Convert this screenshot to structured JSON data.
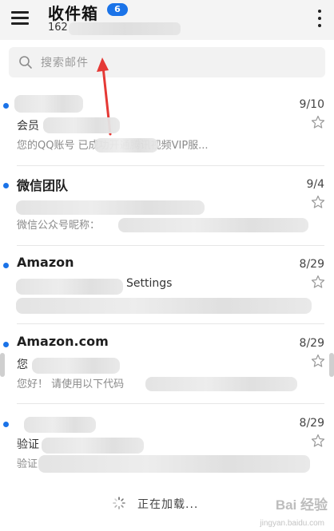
{
  "header": {
    "title": "收件箱",
    "unread_count": "6",
    "account_visible": "162",
    "menu_icon": "hamburger-menu-icon",
    "more_icon": "more-vertical-icon"
  },
  "search": {
    "placeholder": "搜索邮件",
    "icon": "search-icon"
  },
  "mails": [
    {
      "sender": "",
      "date": "9/10",
      "subject": "会员",
      "preview": "您的QQ账号        已成功开通腾讯视频VIP服...",
      "unread": true
    },
    {
      "sender": "微信团队",
      "date": "9/4",
      "subject": "",
      "preview": "微信公众号昵称：",
      "unread": true
    },
    {
      "sender": "Amazon",
      "date": "8/29",
      "subject": "Settings",
      "preview": "",
      "unread": true
    },
    {
      "sender": "Amazon.com",
      "date": "8/29",
      "subject": "您",
      "preview": "您好！ 请使用以下代码",
      "unread": true
    },
    {
      "sender": "",
      "date": "8/29",
      "subject": "验证",
      "preview": "验证",
      "unread": true
    }
  ],
  "loading": {
    "text": "正在加载..."
  },
  "watermark": {
    "brand": "Bai 经验",
    "url": "jingyan.baidu.com"
  },
  "colors": {
    "accent": "#1a73e8",
    "header_bg": "#f4f4f4",
    "arrow": "#e53935"
  }
}
